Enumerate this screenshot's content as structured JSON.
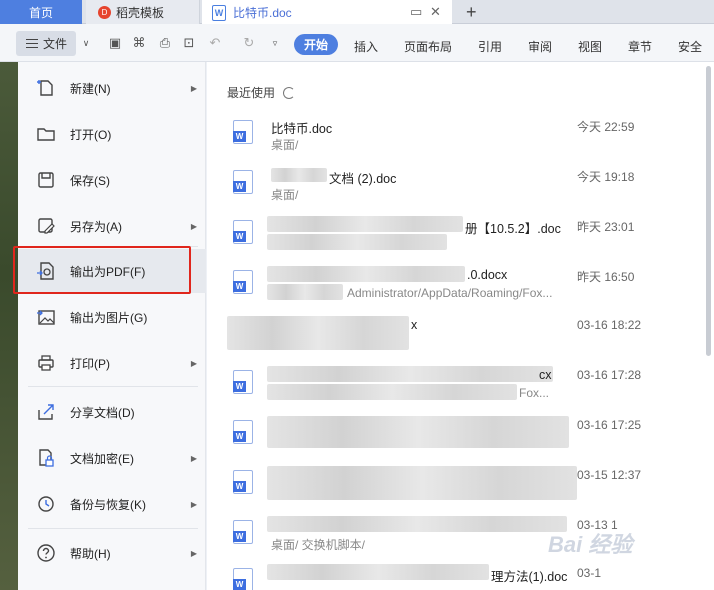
{
  "tabs": {
    "home": "首页",
    "template": "稻壳模板",
    "template_logo": "D",
    "doc": "比特币.doc",
    "doc_icon": "W",
    "new_tab": "+"
  },
  "toolbar": {
    "file_label": "文件",
    "start": "开始",
    "menus": [
      "插入",
      "页面布局",
      "引用",
      "审阅",
      "视图",
      "章节",
      "安全"
    ]
  },
  "file_menu": {
    "items": [
      {
        "label": "新建(N)",
        "icon": "new-file-icon",
        "arrow": true
      },
      {
        "label": "打开(O)",
        "icon": "folder-icon",
        "arrow": false
      },
      {
        "label": "保存(S)",
        "icon": "save-icon",
        "arrow": false
      },
      {
        "label": "另存为(A)",
        "icon": "save-as-icon",
        "arrow": true
      },
      {
        "label": "输出为PDF(F)",
        "icon": "export-pdf-icon",
        "arrow": false,
        "active": true
      },
      {
        "label": "输出为图片(G)",
        "icon": "export-image-icon",
        "arrow": false
      },
      {
        "label": "打印(P)",
        "icon": "printer-icon",
        "arrow": true
      },
      {
        "label": "分享文档(D)",
        "icon": "share-icon",
        "arrow": false
      },
      {
        "label": "文档加密(E)",
        "icon": "lock-doc-icon",
        "arrow": true
      },
      {
        "label": "备份与恢复(K)",
        "icon": "backup-icon",
        "arrow": true
      },
      {
        "label": "帮助(H)",
        "icon": "help-icon",
        "arrow": true
      }
    ]
  },
  "recent": {
    "title": "最近使用",
    "files": [
      {
        "name": "比特币.doc",
        "path": "桌面/",
        "time": "今天 22:59"
      },
      {
        "name": "文档 (2).doc",
        "path": "桌面/",
        "time": "今天 19:18"
      },
      {
        "name": "册【10.5.2】.doc",
        "path": "",
        "time": "昨天 23:01"
      },
      {
        "name": ".0.docx",
        "path": "Administrator/AppData/Roaming/Fox...",
        "time": "昨天 16:50"
      },
      {
        "name": "x",
        "path": "",
        "time": "03-16 18:22"
      },
      {
        "name": "cx",
        "path": "Fox...",
        "time": "03-16 17:28"
      },
      {
        "name": "",
        "path": "",
        "time": "03-16 17:25"
      },
      {
        "name": "",
        "path": "",
        "time": "03-15 12:37"
      },
      {
        "name": "",
        "path": "桌面/ 交换机脚本/",
        "time": "03-13 1"
      },
      {
        "name": "理方法(1).doc",
        "path": "",
        "time": "03-1"
      }
    ]
  },
  "watermark": "Bai 经验"
}
